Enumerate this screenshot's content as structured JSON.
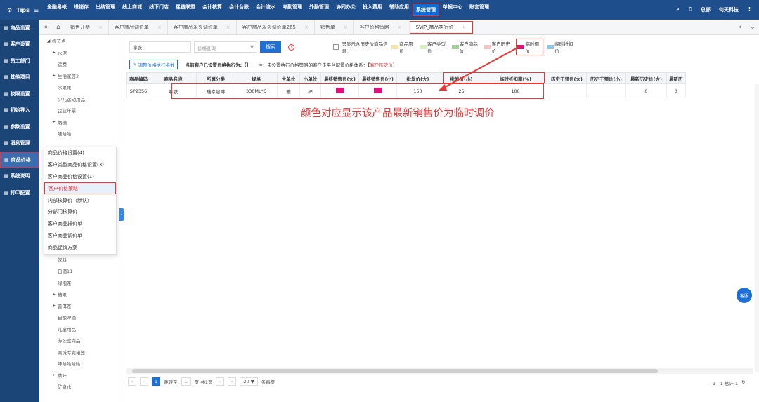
{
  "topbar": {
    "logo": "Tips",
    "menu": [
      "全融易帐",
      "进销存",
      "出纳管理",
      "线上商城",
      "线下门店",
      "星链联盟",
      "会计核算",
      "会计台账",
      "会计流水",
      "考勤管理",
      "外勤管理",
      "协同办公",
      "投入费用",
      "辅助应用",
      "系统管理",
      "单据中心",
      "账套管理"
    ],
    "active_menu": "系统管理",
    "user": "总部",
    "username": "何天科技"
  },
  "sidebar": {
    "items": [
      {
        "label": "商品设置",
        "icon": "grid-icon"
      },
      {
        "label": "客户设置",
        "icon": "grid-icon"
      },
      {
        "label": "员工部门",
        "icon": "grid-icon"
      },
      {
        "label": "其他项目",
        "icon": "box-icon"
      },
      {
        "label": "权限设置",
        "icon": "shield-icon"
      },
      {
        "label": "初始导入",
        "icon": "import-icon"
      },
      {
        "label": "参数设置",
        "icon": "list-icon"
      },
      {
        "label": "消息管理",
        "icon": "message-icon"
      },
      {
        "label": "商品价格",
        "icon": "grid-icon",
        "active": true
      },
      {
        "label": "系统说明",
        "icon": "grid-icon"
      },
      {
        "label": "打印配置",
        "icon": "grid-icon"
      }
    ]
  },
  "tabs": [
    "销售开票",
    "客户商品调价单",
    "客户商品永久调价单",
    "客户商品永久调价单265",
    "销售单",
    "客户价格策略",
    "SVIP_商品执行价"
  ],
  "active_tab": "SVIP_商品执行价",
  "tree": {
    "top": [
      {
        "label": "根节点",
        "t": "◢"
      },
      {
        "label": "水泥",
        "t": "▸"
      },
      {
        "label": "运费",
        "t": ""
      },
      {
        "label": "生活家居2",
        "t": "▸"
      },
      {
        "label": "水果果",
        "t": ""
      },
      {
        "label": "少儿运动用品",
        "t": ""
      },
      {
        "label": "企业年票",
        "t": ""
      },
      {
        "label": "烟糖",
        "t": "▸"
      },
      {
        "label": "哇哈哈",
        "t": ""
      }
    ],
    "bottom": [
      {
        "label": "饮料",
        "t": ""
      },
      {
        "label": "白酒11",
        "t": ""
      },
      {
        "label": "绿泡茶",
        "t": ""
      },
      {
        "label": "糖果",
        "t": "▸"
      },
      {
        "label": "普洱茶",
        "t": "▸"
      },
      {
        "label": "自酿啤酒",
        "t": ""
      },
      {
        "label": "儿童用品",
        "t": ""
      },
      {
        "label": "办公室商品",
        "t": ""
      },
      {
        "label": "商城专卖电器",
        "t": ""
      },
      {
        "label": "哇哈哈哈哈",
        "t": ""
      },
      {
        "label": "茶叶",
        "t": "▸"
      },
      {
        "label": "矿泉水",
        "t": ""
      }
    ]
  },
  "popup": [
    "商品价格设置(4)",
    "客户类型商品价格设置(3)",
    "客户商品价格设置(1)",
    "客户价格策略",
    "内部核算价（默认）",
    "分部门核算价",
    "客户商品报价单",
    "客户商品调价单",
    "商品促销方案"
  ],
  "popup_active": "客户价格策略",
  "filter": {
    "search_value": "拿铁",
    "select_placeholder": "价格查询",
    "search_button": "搜索",
    "only_history_label": "只显示含历史价商品信息"
  },
  "legend": [
    {
      "label": "商品原价",
      "color": "#f3e3a8"
    },
    {
      "label": "客户类型价",
      "color": "#d6ecc4"
    },
    {
      "label": "客户商品价",
      "color": "#a6cfa0"
    },
    {
      "label": "客户历史价",
      "color": "#f2c6c6"
    },
    {
      "label": "临时调价",
      "color": "#e0117a",
      "highlight": true
    },
    {
      "label": "临时折扣价",
      "color": "#8ec5e6"
    }
  ],
  "toolbar": {
    "adjust_button": "调整价格执行参数",
    "current_label": "当前客户已设置价格执行为:【】",
    "note_prefix": "注：未设置执行价格策略的客户走平台配置价格体系：【",
    "note_red": "客户历史价",
    "note_suffix": "】"
  },
  "table": {
    "headers": [
      "商品编码",
      "商品名称",
      "所属分类",
      "规格",
      "大单位",
      "小单位",
      "最终销售价(大)",
      "最终销售价(小)",
      "批发价(大)",
      "批发价(小)",
      "临时折扣率(%)",
      "历史干预价(大)",
      "历史干预价(小)",
      "最新历史价(大)",
      "最新历"
    ],
    "rows": [
      [
        "SP2356",
        "拿铁",
        "瑞幸咖啡",
        "330ML*6",
        "箱",
        "杯",
        "",
        "",
        "150",
        "25",
        "100",
        "",
        "",
        "0",
        "0"
      ]
    ]
  },
  "annotation": "颜色对应显示该产品最新销售价为临时调价",
  "pager": {
    "current": "1",
    "goto_label": "跳转至",
    "goto_value": "1",
    "page_total": "页 共1页",
    "per_page": "20",
    "per_page_label": "条每页",
    "summary": "1 - 1 总计 1"
  },
  "float_label": "客服"
}
